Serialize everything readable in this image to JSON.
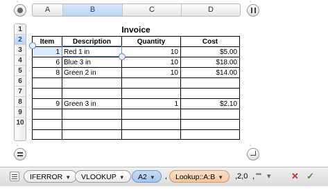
{
  "columns": [
    "A",
    "B",
    "C",
    "D"
  ],
  "rows": [
    "1",
    "2",
    "3",
    "4",
    "5",
    "6",
    "7",
    "8",
    "9",
    "10"
  ],
  "selected_column": "B",
  "selected_row": "2",
  "table": {
    "title": "Invoice",
    "headers": [
      "Item",
      "Description",
      "Quantity",
      "Cost"
    ],
    "data": [
      [
        "1",
        "Red 1 in",
        "10",
        "$5.00"
      ],
      [
        "6",
        "Blue 3 in",
        "10",
        "$18.00"
      ],
      [
        "8",
        "Green 2 in",
        "10",
        "$14.00"
      ],
      [
        "",
        "",
        "",
        ""
      ],
      [
        "",
        "",
        "",
        ""
      ],
      [
        "9",
        "Green 3 in",
        "1",
        "$2.10"
      ],
      [
        "",
        "",
        "",
        ""
      ],
      [
        "",
        "",
        "",
        ""
      ],
      [
        "",
        "",
        "",
        ""
      ]
    ]
  },
  "formula_bar": {
    "fn1": "IFERROR",
    "fn2": "VLOOKUP",
    "arg1": "A2",
    "arg2": "Lookup::A:B",
    "comma1": ",",
    "tail": ",2,0",
    "comma2": ",",
    "quote": "\"\"",
    "cancel": "✕",
    "accept": "✓"
  },
  "colors": {
    "selection": "#5a8fd6",
    "cancel": "#d12b2b",
    "accept": "#2f9a2f"
  }
}
